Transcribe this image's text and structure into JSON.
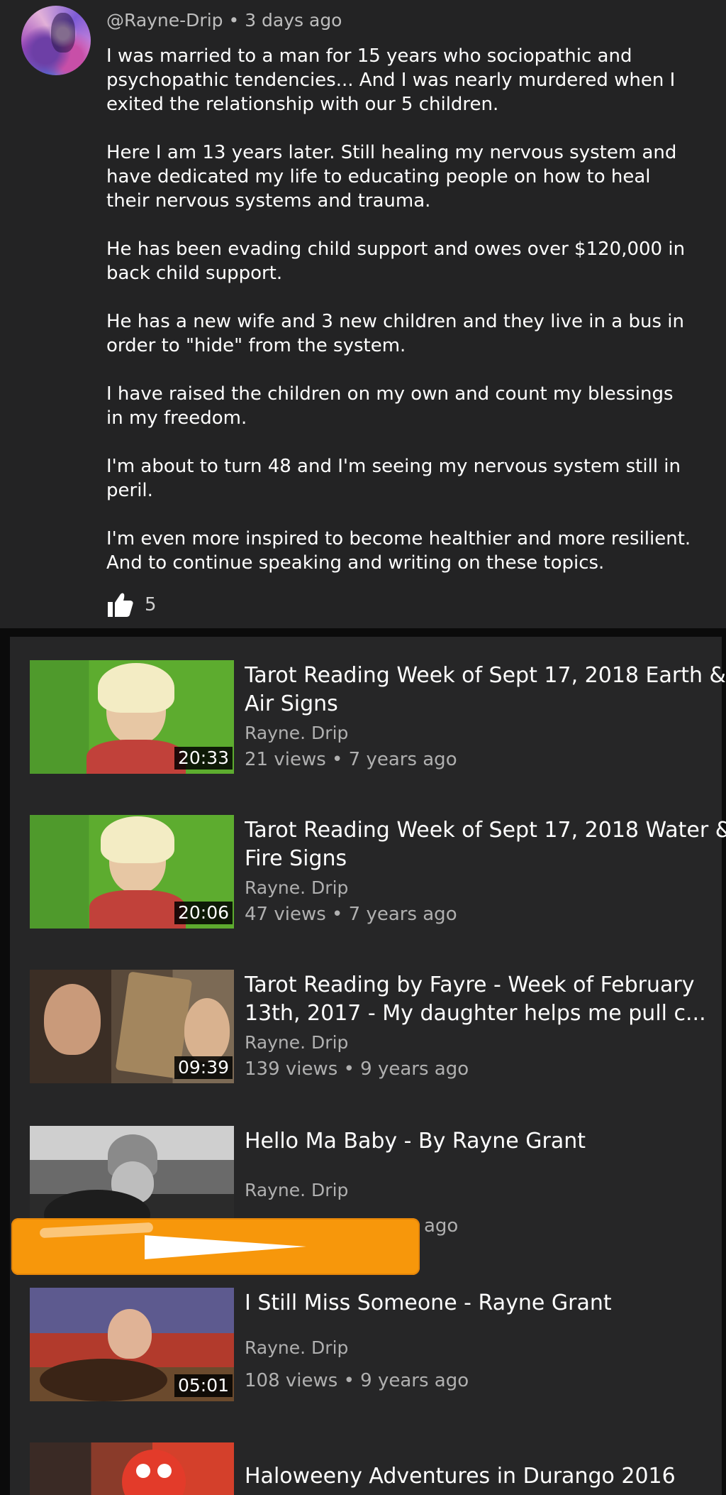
{
  "comment": {
    "author": "@Rayne-Drip",
    "separator": "•",
    "time": "3 days ago",
    "paragraphs": [
      "I was married to a man for 15 years who sociopathic and psychopathic tendencies... And I was nearly murdered when I exited the relationship with our 5 children.",
      "Here I am 13 years later. Still healing my nervous system and have dedicated my life to educating people on how to heal their nervous systems and trauma.",
      "He has been evading child support and owes over $120,000 in back child support.",
      "He has a new wife and 3 new children and they live in a bus in order to \"hide\" from the system.",
      "I have raised the children on my own and count my blessings in my freedom.",
      "I'm about to turn 48 and I'm seeing my nervous system still in peril.",
      "I'm even more inspired to become healthier and more resilient. And to continue speaking and writing on these topics."
    ],
    "likes": "5",
    "like_icon": "thumbs-up-icon"
  },
  "videos": [
    {
      "title": "Tarot Reading Week of Sept 17, 2018 Earth & Air Signs",
      "channel": "Rayne. Drip",
      "stats": "21 views • 7 years ago",
      "duration": "20:33"
    },
    {
      "title": "Tarot Reading Week of Sept 17, 2018 Water & Fire Signs",
      "channel": "Rayne. Drip",
      "stats": "47 views • 7 years ago",
      "duration": "20:06"
    },
    {
      "title": "Tarot Reading by Fayre -  Week of February 13th, 2017 - My daughter helps me pull c...",
      "channel": "Rayne. Drip",
      "stats": "139 views • 9 years ago",
      "duration": "09:39"
    },
    {
      "title": "Hello Ma Baby - By Rayne Grant",
      "channel": "Rayne. Drip",
      "stats": "ago",
      "duration": ""
    },
    {
      "title": "I Still Miss Someone - Rayne Grant",
      "channel": "Rayne. Drip",
      "stats": "108 views • 9 years ago",
      "duration": "05:01"
    },
    {
      "title": "Haloweeny Adventures in Durango 2016",
      "channel": "",
      "stats": "",
      "duration": ""
    }
  ],
  "colors": {
    "background": "#232324",
    "text_primary": "#ffffff",
    "text_secondary": "#b0b0b0",
    "redaction": "#f7970b"
  }
}
